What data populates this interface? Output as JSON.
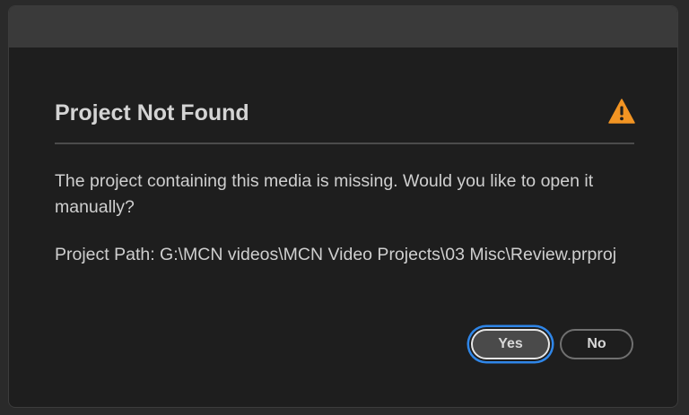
{
  "dialog": {
    "title": "Project Not Found",
    "message": "The project containing this media is missing. Would you like to open it manually?",
    "project_path": "Project Path: G:\\MCN videos\\MCN Video Projects\\03 Misc\\Review.prproj",
    "icon": "warning-icon",
    "icon_color": "#f29423"
  },
  "buttons": {
    "yes_label": "Yes",
    "no_label": "No",
    "focus_ring_color": "#2f86e8"
  }
}
